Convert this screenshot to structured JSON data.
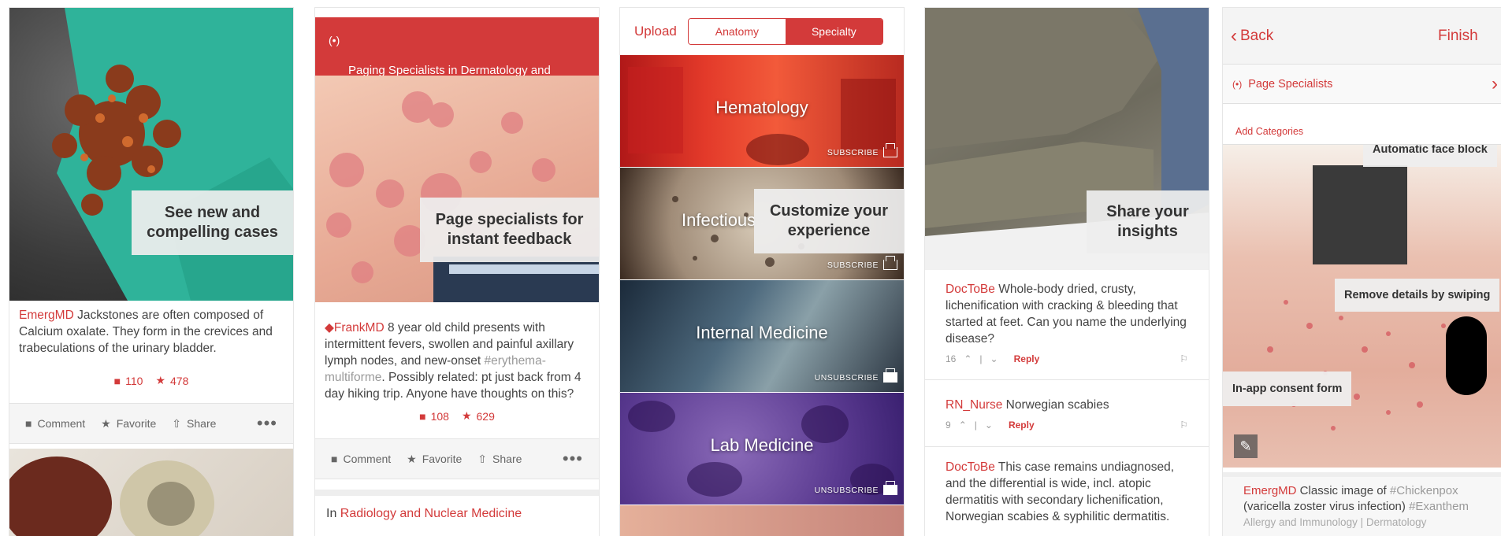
{
  "panel1": {
    "overlay": "See new and\ncompelling cases",
    "post": {
      "user": "EmergMD",
      "text": " Jackstones are often composed of Calcium oxalate. They form in the crevices and trabeculations of the urinary bladder."
    },
    "comments_count": "110",
    "favorites_count": "478",
    "actions": {
      "comment": "Comment",
      "favorite": "Favorite",
      "share": "Share",
      "more": "•••"
    }
  },
  "panel2": {
    "banner": "Paging Specialists in Dermatology and\nInfectious Diseases",
    "overlay": "Page specialists for\ninstant feedback",
    "post": {
      "user": "FrankMD",
      "text": " 8 year old child presents with intermittent fevers, swollen and painful axillary lymph nodes, and new-onset ",
      "hashtag": "#erythema-multiforme",
      "text2": ". Possibly related: pt just back from 4 day hiking trip. Anyone have thoughts on this?"
    },
    "comments_count": "108",
    "favorites_count": "629",
    "actions": {
      "comment": "Comment",
      "favorite": "Favorite",
      "share": "Share",
      "more": "•••"
    },
    "next_in": "In ",
    "next_category": "Radiology and Nuclear Medicine"
  },
  "panel3": {
    "upload": "Upload",
    "tabs": [
      "Anatomy",
      "Specialty"
    ],
    "overlay": "Customize your\nexperience",
    "specialties": [
      {
        "name": "Hematology",
        "status": "SUBSCRIBE"
      },
      {
        "name": "Infectious",
        "status": "SUBSCRIBE"
      },
      {
        "name": "Internal Medicine",
        "status": "UNSUBSCRIBE"
      },
      {
        "name": "Lab Medicine",
        "status": "UNSUBSCRIBE"
      }
    ]
  },
  "panel4": {
    "overlay": "Share your\ninsights",
    "comments": [
      {
        "user": "DocToBe",
        "text": " Whole-body dried, crusty, lichenification with cracking & bleeding that started at feet. Can you name the underlying disease?",
        "votes": "16",
        "reply": "Reply"
      },
      {
        "user": "RN_Nurse",
        "text": " Norwegian scabies",
        "votes": "9",
        "reply": "Reply"
      },
      {
        "user": "DocToBe",
        "text": " This case remains undiagnosed, and the differential is wide, incl. atopic dermatitis with secondary lichenification, Norwegian scabies & syphilitic dermatitis."
      }
    ]
  },
  "panel5": {
    "back": "Back",
    "finish": "Finish",
    "page_specialists": "Page Specialists",
    "add_categories": "Add Categories",
    "labels": {
      "face_block": "Automatic face block",
      "swipe": "Remove details by swiping",
      "consent": "In-app consent form"
    },
    "post": {
      "user": "EmergMD",
      "text": "  Classic image of ",
      "hashtag1": "#Chickenpox",
      "text2": " (varicella zoster virus infection) ",
      "hashtag2": "#Exanthem"
    },
    "categories": "Allergy and Immunology | Dermatology"
  },
  "colors": {
    "accent": "#d33a3a",
    "overlay": "#eeeeee"
  }
}
